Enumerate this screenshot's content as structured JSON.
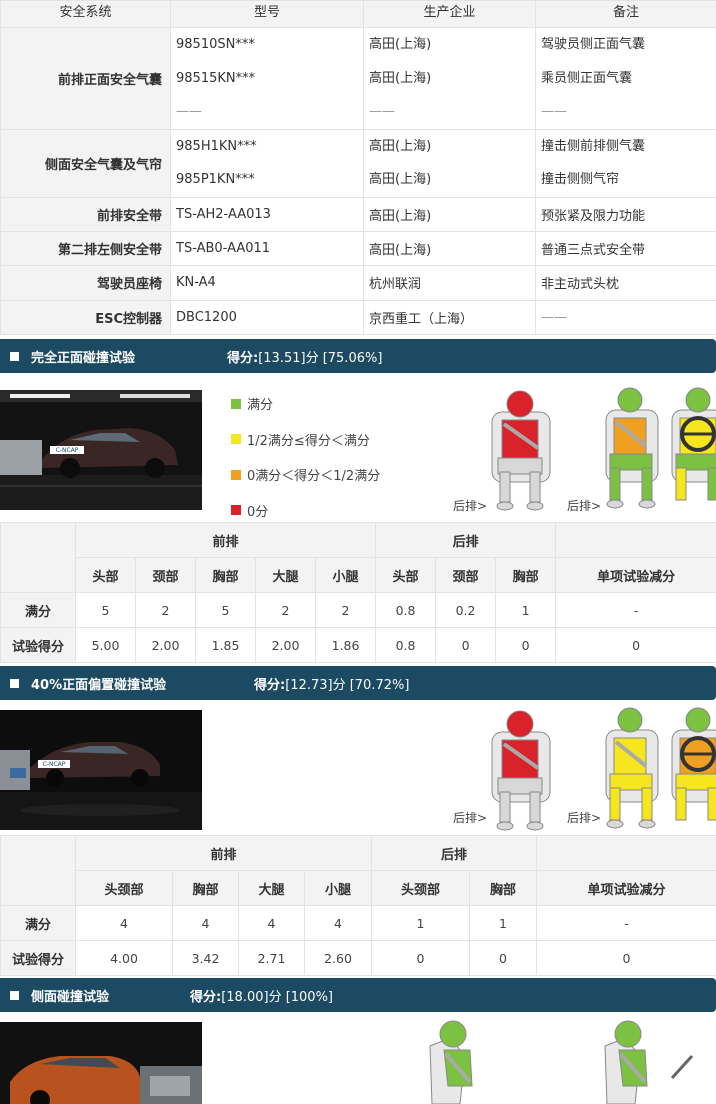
{
  "spec_table": {
    "headers": [
      "安全系统",
      "型号",
      "生产企业",
      "备注"
    ],
    "rows": [
      {
        "label": "前排正面安全气囊",
        "models": [
          "98510SN***",
          "98515KN***",
          "——"
        ],
        "makers": [
          "高田(上海)",
          "高田(上海)",
          "——"
        ],
        "notes": [
          "驾驶员侧正面气囊",
          "乘员侧正面气囊",
          "——"
        ]
      },
      {
        "label": "侧面安全气囊及气帘",
        "models": [
          "985H1KN***",
          "985P1KN***"
        ],
        "makers": [
          "高田(上海)",
          "高田(上海)"
        ],
        "notes": [
          "撞击侧前排侧气囊",
          "撞击侧侧气帘"
        ]
      },
      {
        "label": "前排安全带",
        "models": [
          "TS-AH2-AA013"
        ],
        "makers": [
          "高田(上海)"
        ],
        "notes": [
          "预张紧及限力功能"
        ]
      },
      {
        "label": "第二排左侧安全带",
        "models": [
          "TS-AB0-AA011"
        ],
        "makers": [
          "高田(上海)"
        ],
        "notes": [
          "普通三点式安全带"
        ]
      },
      {
        "label": "驾驶员座椅",
        "models": [
          "KN-A4"
        ],
        "makers": [
          "杭州联润"
        ],
        "notes": [
          "非主动式头枕"
        ]
      },
      {
        "label": "ESC控制器",
        "models": [
          "DBC1200"
        ],
        "makers": [
          "京西重工（上海）"
        ],
        "notes": [
          "——"
        ]
      }
    ]
  },
  "sections": {
    "full_frontal": {
      "title": "完全正面碰撞试验",
      "score_label": "得分:",
      "score_value": "[13.51]分 [75.06%]"
    },
    "offset_frontal": {
      "title": "40%正面偏置碰撞试验",
      "score_label": "得分:",
      "score_value": "[12.73]分 [70.72%]"
    },
    "side": {
      "title": "侧面碰撞试验",
      "score_label": "得分:",
      "score_value": "[18.00]分 [100%]"
    }
  },
  "legend": [
    {
      "label": "满分",
      "color": "#7cc142"
    },
    {
      "label": "1/2满分≤得分＜满分",
      "color": "#f5e61e"
    },
    {
      "label": "0满分＜得分＜1/2满分",
      "color": "#f0a020"
    },
    {
      "label": "0分",
      "color": "#d9222a"
    }
  ],
  "rear_label": "后排>",
  "table1": {
    "group_front": "前排",
    "group_rear": "后排",
    "deduction_header": "单项试验减分",
    "front_cols": [
      "头部",
      "颈部",
      "胸部",
      "大腿",
      "小腿"
    ],
    "rear_cols": [
      "头部",
      "颈部",
      "胸部"
    ],
    "full_label": "满分",
    "full": [
      "5",
      "2",
      "5",
      "2",
      "2",
      "0.8",
      "0.2",
      "1",
      "-"
    ],
    "test_label": "试验得分",
    "test": [
      "5.00",
      "2.00",
      "1.85",
      "2.00",
      "1.86",
      "0.8",
      "0",
      "0",
      "0"
    ]
  },
  "table2": {
    "group_front": "前排",
    "group_rear": "后排",
    "deduction_header": "单项试验减分",
    "front_cols": [
      "头颈部",
      "胸部",
      "大腿",
      "小腿"
    ],
    "rear_cols": [
      "头颈部",
      "胸部"
    ],
    "full_label": "满分",
    "full": [
      "4",
      "4",
      "4",
      "4",
      "1",
      "1",
      "-"
    ],
    "test_label": "试验得分",
    "test": [
      "4.00",
      "3.42",
      "2.71",
      "2.60",
      "0",
      "0",
      "0"
    ]
  },
  "photo_text": {
    "badge": "C-NCAP"
  },
  "dummy_colors": {
    "red": "#d9222a",
    "orange": "#f0a020",
    "yellow": "#f5e61e",
    "green": "#7cc142",
    "seat": "#d8d8d8",
    "outline": "#888888"
  }
}
